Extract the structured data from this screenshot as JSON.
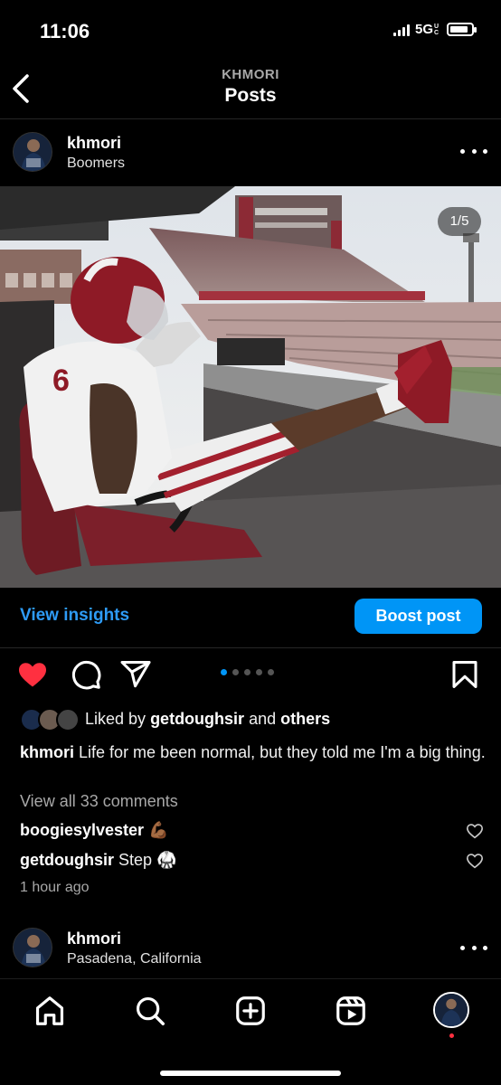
{
  "status_bar": {
    "time": "11:06",
    "network": "5G",
    "network_sup": "UC",
    "battery_level": 0.85
  },
  "header": {
    "account": "KHMORI",
    "title": "Posts"
  },
  "post": {
    "username": "khmori",
    "location": "Boomers",
    "photo_counter": "1/5",
    "carousel": {
      "count": 5,
      "active": 1
    },
    "jersey_number": "6",
    "insights_label": "View insights",
    "boost_label": "Boost post",
    "liked": true,
    "likes": {
      "prefix": "Liked by",
      "user": "getdoughsir",
      "and": "and",
      "others": "others"
    },
    "caption": {
      "username": "khmori",
      "text": "Life for me been normal, but they told me I'm a big thing."
    },
    "view_comments": "View all 33 comments",
    "comments": [
      {
        "user": "boogiesylvester",
        "text": "💪🏾"
      },
      {
        "user": "getdoughsir",
        "text": "Step 🥋"
      }
    ],
    "time_ago": "1 hour ago"
  },
  "next_post": {
    "username": "khmori",
    "location": "Pasadena, California"
  },
  "colors": {
    "accent": "#0095f6",
    "like": "#ff3040",
    "link": "#2e9bf6"
  },
  "icons": [
    "chevron-left-icon",
    "more-icon",
    "heart-icon",
    "comment-icon",
    "share-icon",
    "bookmark-icon",
    "home-icon",
    "search-icon",
    "create-icon",
    "reels-icon",
    "profile-icon"
  ]
}
